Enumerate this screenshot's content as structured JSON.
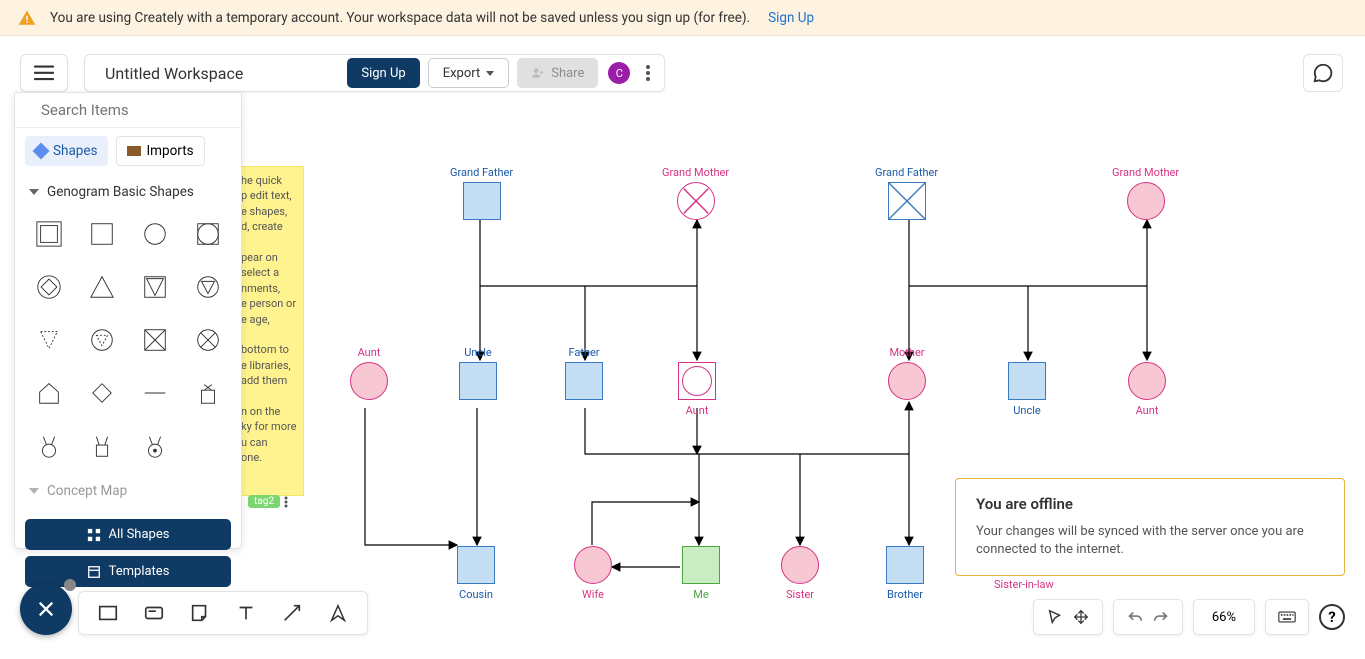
{
  "banner": {
    "text": "You are using Creately with a temporary account. Your workspace data will not be saved unless you sign up (for free).",
    "link": "Sign Up"
  },
  "topbar": {
    "title": "Untitled Workspace",
    "signup": "Sign Up",
    "export": "Export",
    "share": "Share",
    "avatar": "C"
  },
  "search": {
    "placeholder": "Search Items"
  },
  "tabs": {
    "shapes": "Shapes",
    "imports": "Imports"
  },
  "sections": {
    "genogram": "Genogram Basic Shapes",
    "concept": "Concept Map"
  },
  "panel_buttons": {
    "all_shapes": "All Shapes",
    "templates": "Templates"
  },
  "sticky": {
    "text": "he quick\np edit text,\ne shapes,\nd, create\n\npear  on\nselect a\nnments,\ne person or\ne age,\n\nbottom to\ne libraries,\nadd them\n\nn on the\nky for more\nu can\none."
  },
  "tag": "tag2",
  "nodes": {
    "gf1": "Grand Father",
    "gm1": "Grand Mother",
    "gf2": "Grand Father",
    "gm2": "Grand Mother",
    "aunt1": "Aunt",
    "uncle1": "Uncle",
    "father": "Father",
    "aunt2": "Aunt",
    "mother": "Mother",
    "uncle2": "Uncle",
    "aunt3": "Aunt",
    "cousin": "Cousin",
    "wife": "Wife",
    "me": "Me",
    "sister": "Sister",
    "brother": "Brother",
    "sil": "Sister-in-law"
  },
  "toast": {
    "title": "You are offline",
    "body": "Your changes will be synced with the server once you are connected to the internet."
  },
  "zoom": "66%",
  "help": "?"
}
